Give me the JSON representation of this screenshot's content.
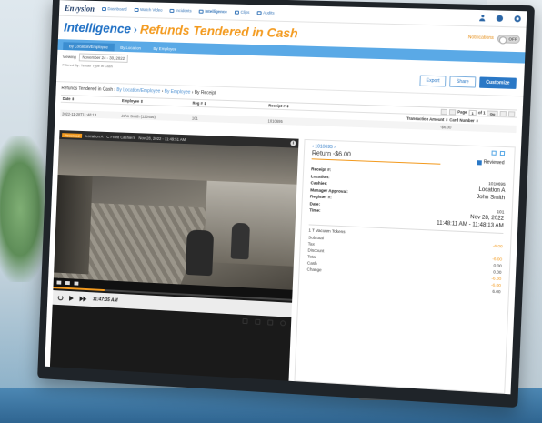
{
  "nav": {
    "brand": "Envysion",
    "items": [
      {
        "label": "Dashboard"
      },
      {
        "label": "Watch Video"
      },
      {
        "label": "Incidents"
      },
      {
        "label": "Intelligence"
      },
      {
        "label": "Clips"
      },
      {
        "label": "Audits"
      }
    ]
  },
  "header": {
    "title": "Intelligence",
    "separator": "›",
    "subtitle": "Refunds Tendered in Cash",
    "notifications_label": "Notifications",
    "notifications_state": "OFF"
  },
  "tabs": [
    {
      "label": "By Location/Employee"
    },
    {
      "label": "By Location"
    },
    {
      "label": "By Employee"
    }
  ],
  "filters": {
    "viewing_label": "Viewing",
    "date_range": "November 24 - 30, 2022",
    "filtered_by": "Filtered By: Tender Type in Cash"
  },
  "actions": {
    "export": "Export",
    "share": "Share",
    "customize": "Customize"
  },
  "breadcrumb": {
    "root": "Refunds Tendered in Cash",
    "sep": " › ",
    "level1": "By Location/Employee",
    "level2": "By Employee",
    "level3": "By Receipt"
  },
  "table": {
    "headers": [
      "Date ⇕",
      "Employee ⇕",
      "Reg # ⇕",
      "Receipt # ⇕",
      "Transaction Amount ⇕  Card Number ⇕"
    ],
    "row": [
      "2022-11-28T11:48:13",
      "John Smith (123456)",
      "101",
      "1010695",
      "-$6.00"
    ],
    "pager": {
      "page_label": "Page",
      "page": "1",
      "of": "of 1",
      "go": "Go"
    }
  },
  "video": {
    "rec_label": "Recorded",
    "location": "Location A",
    "camera": "C Front Cashiers",
    "timestamp": "Nov 28, 2022 - 11:49:51 AM",
    "time": "11:47:35 AM",
    "progress_fraction": 0.22
  },
  "receipt": {
    "nav": "‹ 1010695 ›",
    "title": "Return -$6.00",
    "reviewed_label": "Reviewed",
    "fields": [
      {
        "label": "Receipt #:",
        "value": ""
      },
      {
        "label": "Location:",
        "value": "1010695"
      },
      {
        "label": "Cashier:",
        "value": "Location A"
      },
      {
        "label": "Manager Approval:",
        "value": "John Smith"
      },
      {
        "label": "Register #:",
        "value": ""
      },
      {
        "label": "Date:",
        "value": "101"
      },
      {
        "label": "Time:",
        "value": "Nov 28, 2022"
      }
    ],
    "time_range": "11:48:11 AM - 11:48:13 AM",
    "item": "1  T Vacuum Tokens",
    "totals": [
      {
        "label": "Subtotal",
        "value": "-6.00"
      },
      {
        "label": "Tax",
        "value": ""
      },
      {
        "label": "Discount",
        "value": "-6.00"
      },
      {
        "label": "Total",
        "value": "0.00"
      },
      {
        "label": "Cash",
        "value": "0.00"
      },
      {
        "label": "Change",
        "value": "-6.00"
      }
    ],
    "extra_values": [
      "-6.00",
      "6.00"
    ]
  },
  "colors": {
    "accent_blue": "#1e6fc4",
    "accent_orange": "#f39a1e",
    "tab_blue": "#5aa9e6"
  }
}
